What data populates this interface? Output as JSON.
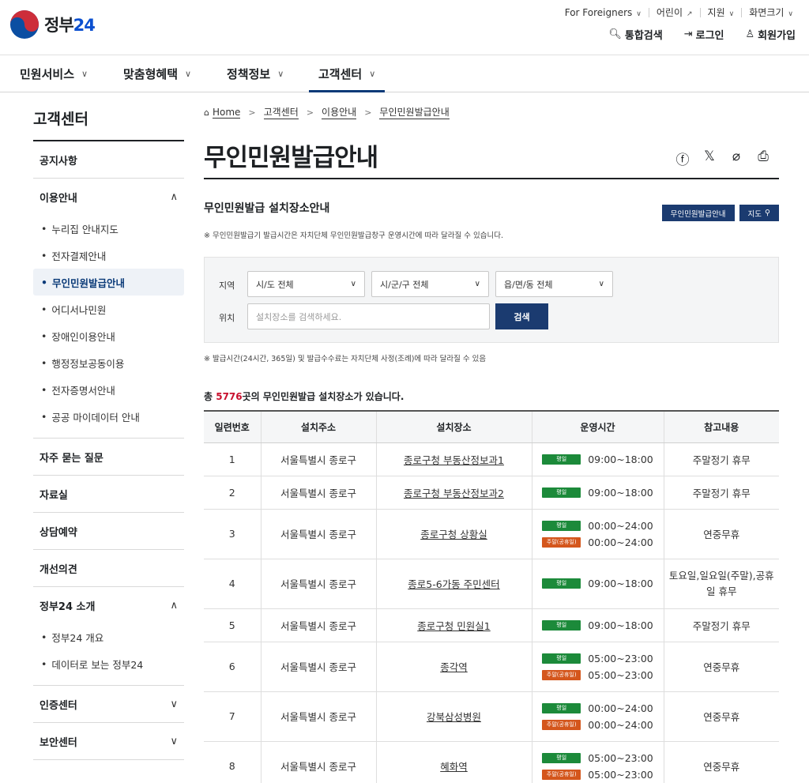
{
  "header": {
    "logo_text_main": "정부",
    "logo_text_num": "24",
    "util": [
      "For Foreigners",
      "어린이",
      "지원",
      "화면크기"
    ],
    "actions": [
      {
        "icon": "search-icon",
        "label": "통합검색"
      },
      {
        "icon": "login-icon",
        "label": "로그인"
      },
      {
        "icon": "user-plus-icon",
        "label": "회원가입"
      }
    ]
  },
  "gnb": [
    "민원서비스",
    "맞춤형혜택",
    "정책정보",
    "고객센터"
  ],
  "sidebar": {
    "title": "고객센터",
    "sections": [
      {
        "label": "공지사항"
      },
      {
        "label": "이용안내",
        "items": [
          "누리집 안내지도",
          "전자결제안내",
          "무인민원발급안내",
          "어디서나민원",
          "장애인이용안내",
          "행정정보공동이용",
          "전자증명서안내",
          "공공 마이데이터 안내"
        ]
      },
      {
        "label": "자주 묻는 질문"
      },
      {
        "label": "자료실"
      },
      {
        "label": "상담예약"
      },
      {
        "label": "개선의견"
      },
      {
        "label": "정부24 소개",
        "items": [
          "정부24 개요",
          "데이터로 보는 정부24"
        ]
      },
      {
        "label": "인증센터"
      },
      {
        "label": "보안센터"
      }
    ]
  },
  "breadcrumb": [
    "Home",
    "고객센터",
    "이용안내",
    "무인민원발급안내"
  ],
  "page_title": "무인민원발급안내",
  "section": {
    "title": "무인민원발급 설치장소안내",
    "btn_guide": "무인민원발급안내",
    "btn_map": "지도",
    "note1": "※ 무인민원발급기 발급시간은 자치단체 무인민원발급창구 운영시간에 따라 달라질 수 있습니다."
  },
  "search": {
    "region_label": "지역",
    "location_label": "위치",
    "sido": "시/도 전체",
    "sigungu": "시/군/구 전체",
    "eupmyeondong": "읍/면/동 전체",
    "placeholder": "설치장소를 검색하세요.",
    "button": "검색"
  },
  "note2": "※ 발급시간(24시간, 365일) 및 발급수수료는 자치단체 사정(조례)에 따라 달라질 수 있음",
  "total": {
    "prefix": "총 ",
    "count": "5776",
    "suffix": "곳의 무인민원발급 설치장소가 있습니다."
  },
  "table": {
    "headers": [
      "일련번호",
      "설치주소",
      "설치장소",
      "운영시간",
      "참고내용"
    ],
    "badge_weekday": "평일",
    "badge_holiday": "주말(공휴일)",
    "rows": [
      {
        "no": "1",
        "addr": "서울특별시 종로구",
        "place": "종로구청 부동산정보과1",
        "weekday": "09:00~18:00",
        "holiday": null,
        "note": "주말정기 휴무"
      },
      {
        "no": "2",
        "addr": "서울특별시 종로구",
        "place": "종로구청 부동산정보과2",
        "weekday": "09:00~18:00",
        "holiday": null,
        "note": "주말정기 휴무"
      },
      {
        "no": "3",
        "addr": "서울특별시 종로구",
        "place": "종로구청 상황실",
        "weekday": "00:00~24:00",
        "holiday": "00:00~24:00",
        "note": "연중무휴"
      },
      {
        "no": "4",
        "addr": "서울특별시 종로구",
        "place": "종로5-6가동 주민센터",
        "weekday": "09:00~18:00",
        "holiday": null,
        "note": "토요일,일요일(주말),공휴일 휴무"
      },
      {
        "no": "5",
        "addr": "서울특별시 종로구",
        "place": "종로구청 민원실1",
        "weekday": "09:00~18:00",
        "holiday": null,
        "note": "주말정기 휴무"
      },
      {
        "no": "6",
        "addr": "서울특별시 종로구",
        "place": "종각역",
        "weekday": "05:00~23:00",
        "holiday": "05:00~23:00",
        "note": "연중무휴"
      },
      {
        "no": "7",
        "addr": "서울특별시 종로구",
        "place": "강북삼성병원",
        "weekday": "00:00~24:00",
        "holiday": "00:00~24:00",
        "note": "연중무휴"
      },
      {
        "no": "8",
        "addr": "서울특별시 종로구",
        "place": "혜화역",
        "weekday": "05:00~23:00",
        "holiday": "05:00~23:00",
        "note": "연중무휴"
      }
    ]
  }
}
